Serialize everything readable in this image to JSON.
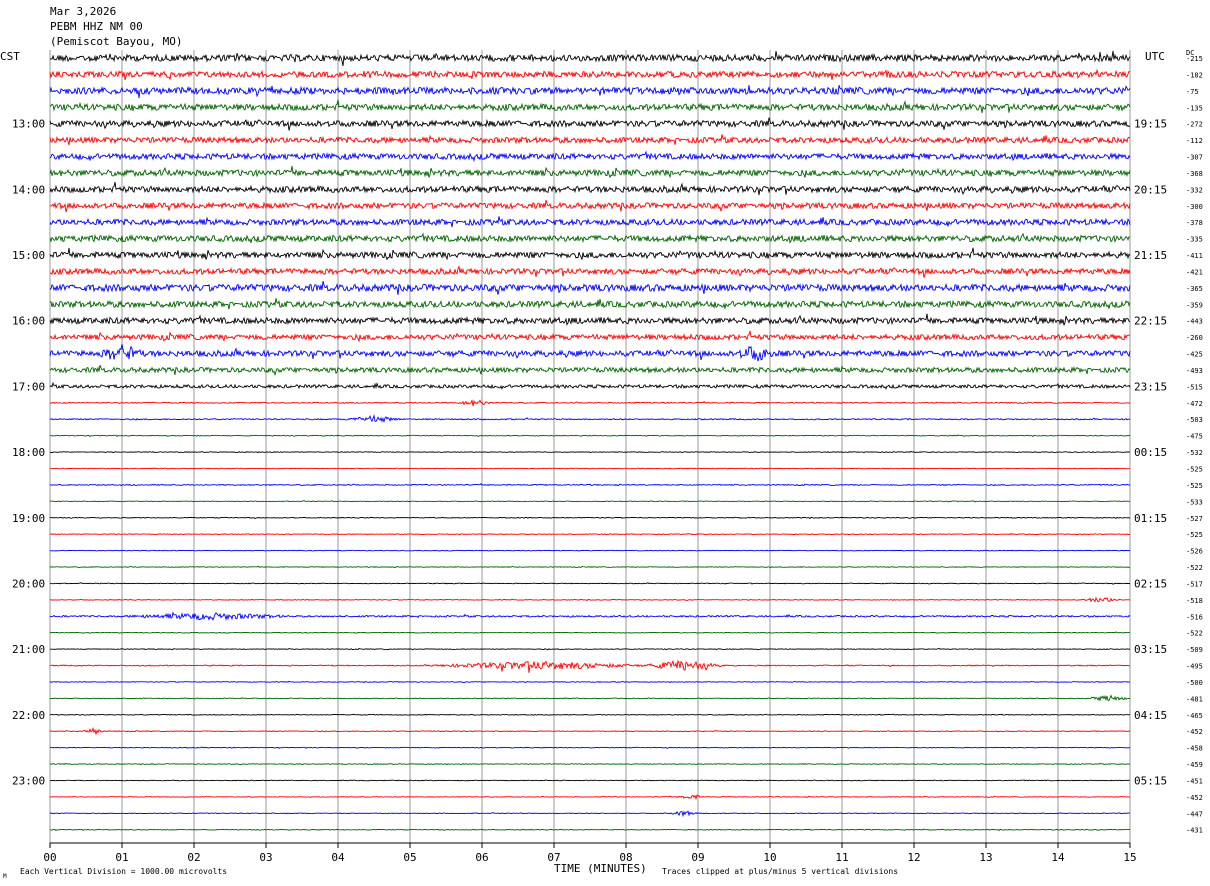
{
  "header": {
    "date": "Mar 3,2026",
    "station": "PEBM HHZ NM 00",
    "location": "(Pemiscot Bayou, MO)"
  },
  "left_timezone": "CST",
  "right_timezone": "UTC",
  "dc_label": "DC",
  "footer": {
    "scale_note": "Each Vertical Division = 1000.00 microvolts",
    "clip_note": "Traces clipped at plus/minus 5 vertical divisions",
    "corner_mark": "M"
  },
  "colors": {
    "black": "#000000",
    "red": "#ff0000",
    "blue": "#0000ff",
    "green": "#006400",
    "grid": "#555555"
  },
  "chart_data": {
    "type": "line",
    "title": "PEBM HHZ NM 00",
    "xlabel": "TIME (MINUTES)",
    "xlim": [
      0,
      15
    ],
    "x_tick_labels": [
      "00",
      "01",
      "02",
      "03",
      "04",
      "05",
      "06",
      "07",
      "08",
      "09",
      "10",
      "11",
      "12",
      "13",
      "14",
      "15"
    ],
    "traces_per_hour": 4,
    "trace_colors": [
      "black",
      "red",
      "blue",
      "green"
    ],
    "left_hour_labels": [
      "13:00",
      "14:00",
      "15:00",
      "16:00",
      "17:00",
      "18:00",
      "19:00",
      "20:00",
      "21:00",
      "22:00",
      "23:00"
    ],
    "right_hour_labels": [
      "19:15",
      "20:15",
      "21:15",
      "22:15",
      "23:15",
      "00:15",
      "01:15",
      "02:15",
      "03:15",
      "04:15",
      "05:15"
    ],
    "dc_offsets": [
      "-215",
      "-182",
      "-75",
      "-135",
      "-272",
      "-112",
      "-307",
      "-368",
      "-332",
      "-300",
      "-378",
      "-335",
      "-411",
      "-421",
      "-365",
      "-359",
      "-443",
      "-260",
      "-425",
      "-493",
      "-515",
      "-472",
      "-503",
      "-475",
      "-532",
      "-525",
      "-525",
      "-533",
      "-527",
      "-525",
      "-526",
      "-522",
      "-517",
      "-518",
      "-516",
      "-522",
      "-509",
      "-495",
      "-500",
      "-481",
      "-465",
      "-452",
      "-458",
      "-459",
      "-451",
      "-452",
      "-447",
      "-431"
    ],
    "amplitude_levels": [
      3.2,
      3.0,
      3.4,
      3.1,
      3.0,
      2.8,
      2.8,
      3.0,
      3.0,
      2.8,
      2.9,
      3.0,
      3.0,
      2.8,
      3.4,
      3.0,
      3.0,
      2.6,
      2.8,
      2.4,
      1.6,
      0.5,
      0.6,
      0.4,
      0.35,
      0.35,
      0.5,
      0.35,
      0.35,
      0.35,
      0.35,
      0.35,
      0.35,
      0.35,
      0.8,
      0.35,
      0.35,
      0.5,
      0.35,
      0.35,
      0.35,
      0.35,
      0.35,
      0.35,
      0.35,
      0.35,
      0.35,
      0.35
    ],
    "events": [
      {
        "trace": 18,
        "minute": 1.0,
        "amp": 7,
        "width": 0.3
      },
      {
        "trace": 18,
        "minute": 9.8,
        "amp": 6,
        "width": 0.3
      },
      {
        "trace": 21,
        "minute": 5.9,
        "amp": 3,
        "width": 0.25
      },
      {
        "trace": 22,
        "minute": 4.5,
        "amp": 3,
        "width": 0.4
      },
      {
        "trace": 34,
        "minute": 2.2,
        "amp": 3,
        "width": 1.2
      },
      {
        "trace": 37,
        "minute": 6.8,
        "amp": 4,
        "width": 1.6
      },
      {
        "trace": 37,
        "minute": 8.8,
        "amp": 5,
        "width": 0.6
      },
      {
        "trace": 41,
        "minute": 0.6,
        "amp": 3.5,
        "width": 0.15
      },
      {
        "trace": 39,
        "minute": 14.7,
        "amp": 3,
        "width": 0.3
      },
      {
        "trace": 33,
        "minute": 14.6,
        "amp": 2.5,
        "width": 0.3
      },
      {
        "trace": 46,
        "minute": 8.8,
        "amp": 2.5,
        "width": 0.2
      },
      {
        "trace": 45,
        "minute": 8.9,
        "amp": 2.5,
        "width": 0.2
      }
    ]
  }
}
